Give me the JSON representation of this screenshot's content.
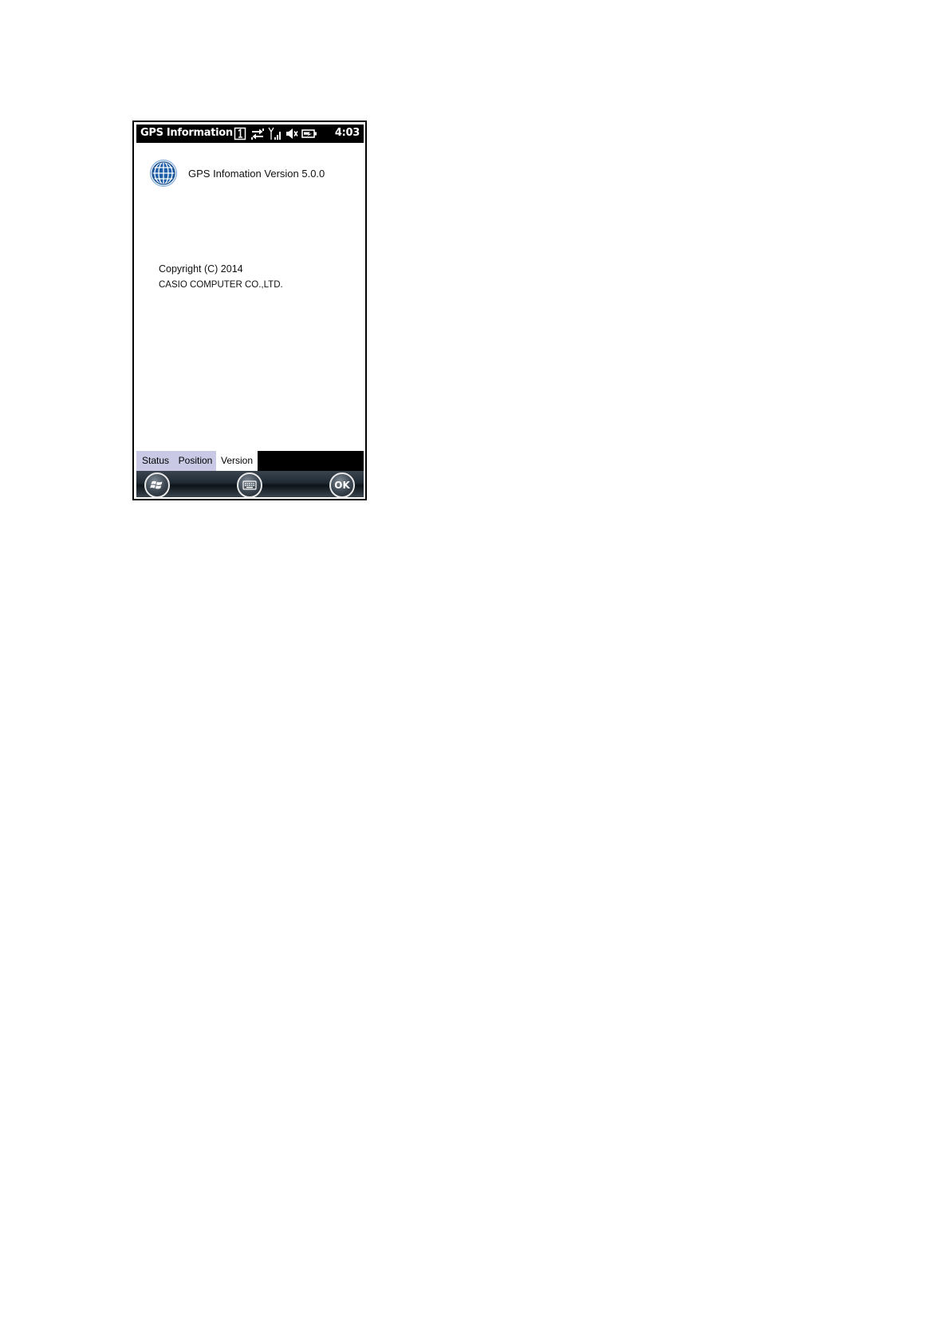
{
  "status_bar": {
    "app_title": "GPS Information",
    "clock": "4:03",
    "icons": [
      "sim-slot-1-icon",
      "data-transfer-icon",
      "signal-strength-icon",
      "speaker-muted-icon",
      "battery-charging-icon"
    ]
  },
  "content": {
    "app_icon": "globe-icon",
    "version_text": "GPS Infomation Version 5.0.0",
    "copyright": "Copyright (C) 2014",
    "company": "CASIO COMPUTER CO.,LTD."
  },
  "tabs": [
    {
      "label": "Status",
      "active": false
    },
    {
      "label": "Position",
      "active": false
    },
    {
      "label": "Version",
      "active": true
    }
  ],
  "softkeys": {
    "start_icon": "windows-start-icon",
    "keyboard_icon": "keyboard-icon",
    "ok_label": "OK"
  },
  "colors": {
    "status_bar_bg": "#000000",
    "tab_inactive_bg": "#c9c9e6",
    "tab_active_bg": "#ffffff",
    "globe_blue": "#1e5fa8"
  }
}
